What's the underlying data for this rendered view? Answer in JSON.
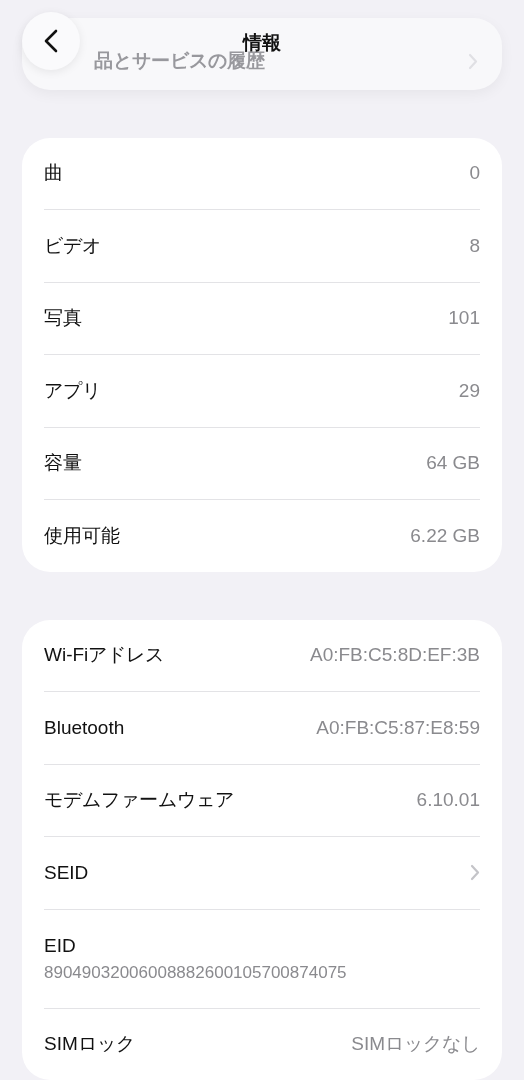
{
  "header": {
    "title": "情報"
  },
  "history_row": {
    "label": "品とサービスの履歴"
  },
  "sections": [
    {
      "rows": [
        {
          "kind": "value",
          "label": "曲",
          "value": "0"
        },
        {
          "kind": "value",
          "label": "ビデオ",
          "value": "8"
        },
        {
          "kind": "value",
          "label": "写真",
          "value": "101"
        },
        {
          "kind": "value",
          "label": "アプリ",
          "value": "29"
        },
        {
          "kind": "value",
          "label": "容量",
          "value": "64 GB"
        },
        {
          "kind": "value",
          "label": "使用可能",
          "value": "6.22 GB"
        }
      ]
    },
    {
      "rows": [
        {
          "kind": "value",
          "label": "Wi-Fiアドレス",
          "value": "A0:FB:C5:8D:EF:3B"
        },
        {
          "kind": "value",
          "label": "Bluetooth",
          "value": "A0:FB:C5:87:E8:59"
        },
        {
          "kind": "value",
          "label": "モデムファームウェア",
          "value": "6.10.01"
        },
        {
          "kind": "chevron",
          "label": "SEID"
        },
        {
          "kind": "stacked",
          "label": "EID",
          "value": "89049032006008882600105700874075"
        },
        {
          "kind": "value",
          "label": "SIMロック",
          "value": "SIMロックなし"
        }
      ]
    }
  ]
}
